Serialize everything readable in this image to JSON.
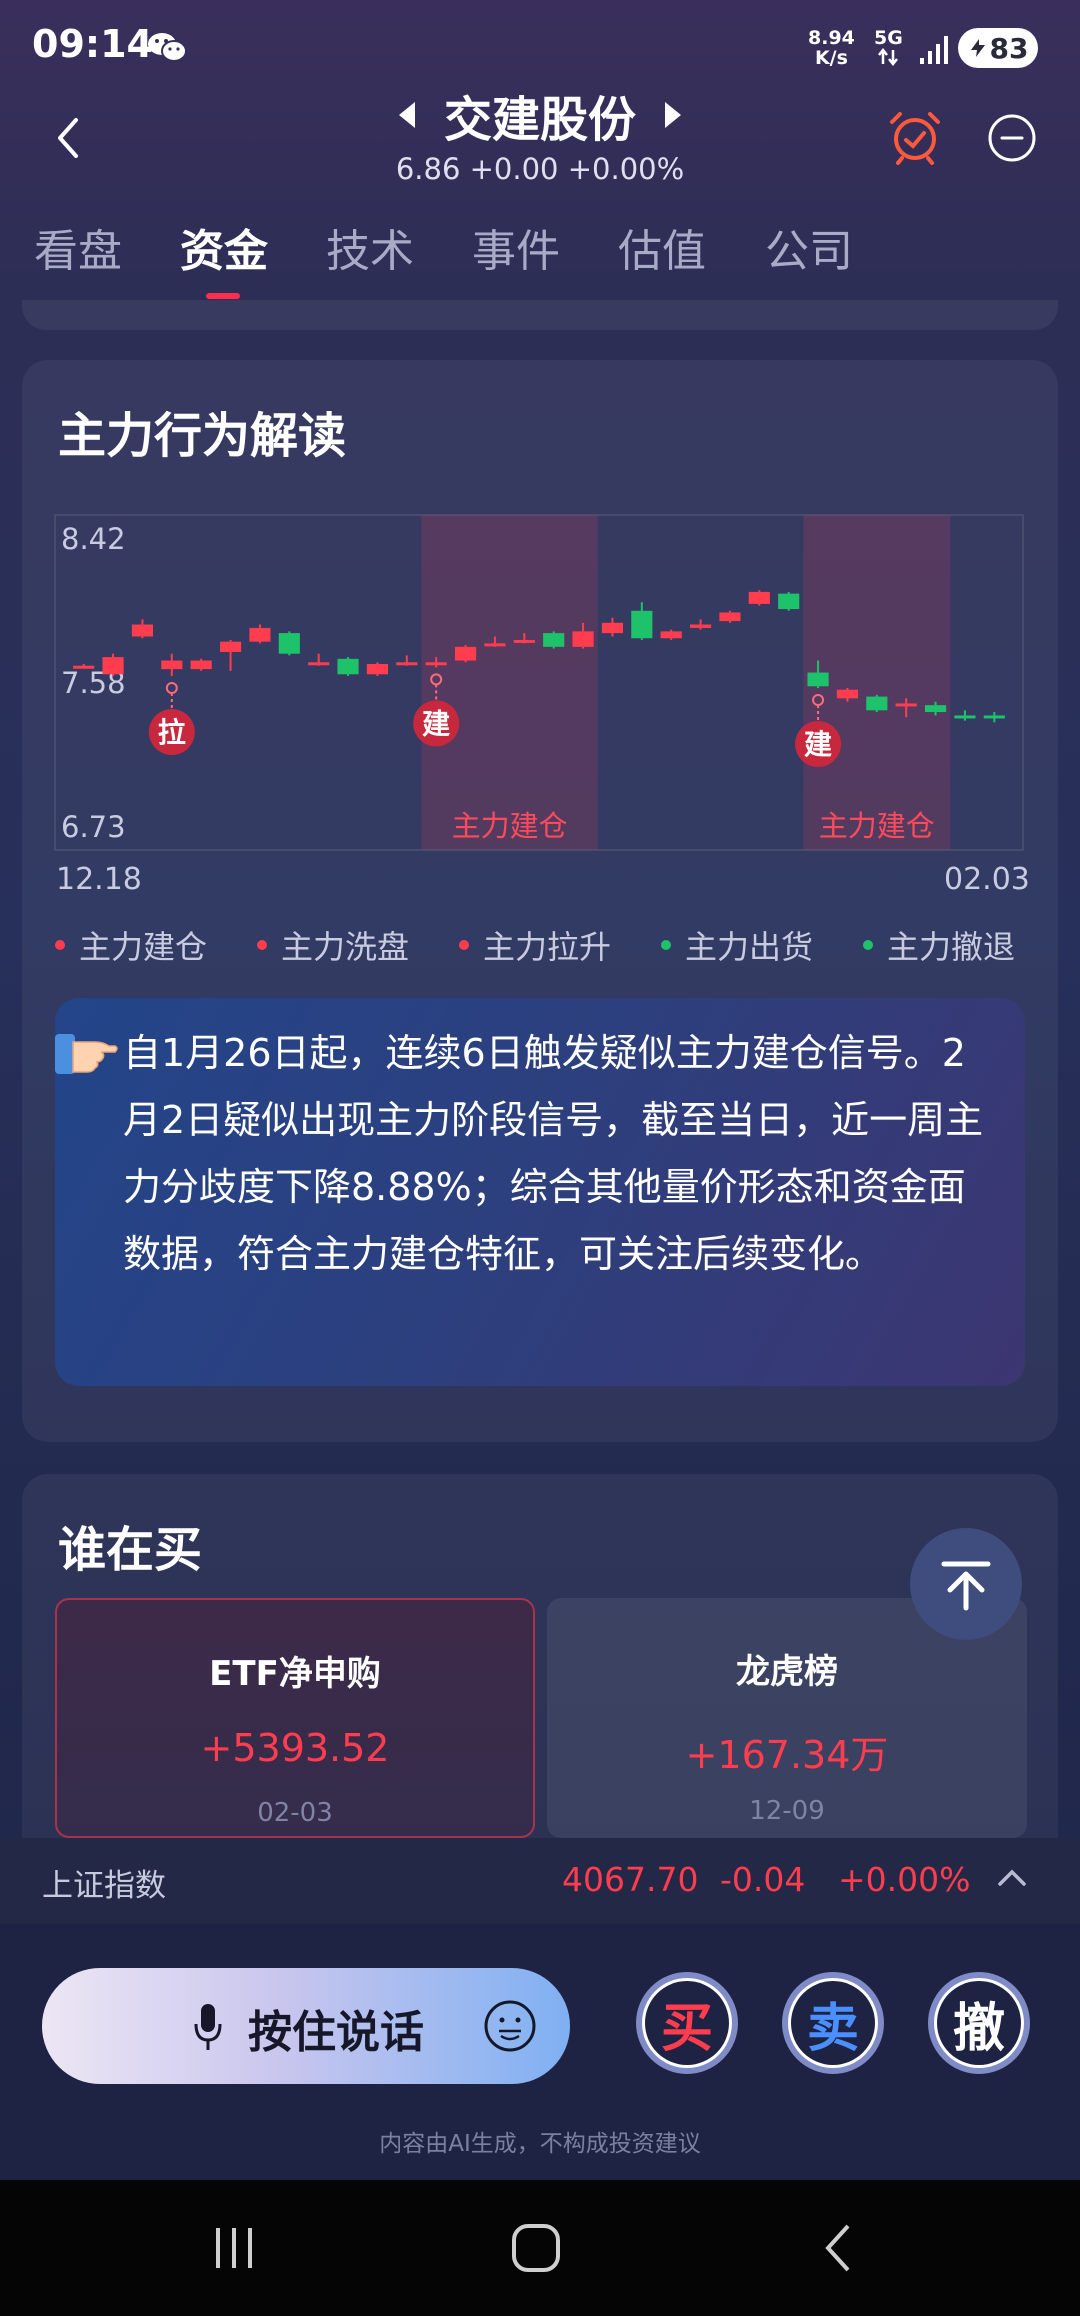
{
  "status_bar": {
    "time": "09:14",
    "net_speed_value": "8.94",
    "net_speed_unit": "K/s",
    "network": "5G",
    "battery": "83",
    "icons": [
      "wechat-icon",
      "data-arrows-icon",
      "signal-icon",
      "charging-icon"
    ]
  },
  "header": {
    "title": "交建股份",
    "price_line": "6.86 +0.00 +0.00%",
    "icons": [
      "back-icon",
      "prev-stock-icon",
      "next-stock-icon",
      "alarm-clock-icon",
      "minus-circle-icon"
    ]
  },
  "tabs": [
    {
      "label": "看盘",
      "active": false
    },
    {
      "label": "资金",
      "active": true
    },
    {
      "label": "技术",
      "active": false
    },
    {
      "label": "事件",
      "active": false
    },
    {
      "label": "估值",
      "active": false
    },
    {
      "label": "公司",
      "active": false
    }
  ],
  "main_behavior": {
    "title": "主力行为解读",
    "legend": [
      {
        "label": "主力建仓",
        "color": "#ff3d4f"
      },
      {
        "label": "主力洗盘",
        "color": "#ff3d4f"
      },
      {
        "label": "主力拉升",
        "color": "#ff3d4f"
      },
      {
        "label": "主力出货",
        "color": "#1ec26a"
      },
      {
        "label": "主力撤退",
        "color": "#1ec26a"
      }
    ],
    "insight": "自1月26日起，连续6日触发疑似主力建仓信号。2月2日疑似出现主力阶段信号，截至当日，近一周主力分歧度下降8.88%；综合其他量价形态和资金面数据，符合主力建仓特征，可关注后续变化。"
  },
  "chart_data": {
    "type": "candlestick",
    "y_tick_labels": [
      "8.42",
      "7.58",
      "6.73"
    ],
    "ylim": [
      6.73,
      8.42
    ],
    "x_tick_labels": [
      "12.18",
      "02.03"
    ],
    "up_color": "#ff3d4f",
    "down_color": "#1ec26a",
    "candles": [
      {
        "o": 7.67,
        "c": 7.67,
        "h": 7.68,
        "l": 7.66
      },
      {
        "o": 7.62,
        "c": 7.72,
        "h": 7.74,
        "l": 7.61
      },
      {
        "o": 7.84,
        "c": 7.91,
        "h": 7.94,
        "l": 7.83
      },
      {
        "o": 7.65,
        "c": 7.7,
        "h": 7.74,
        "l": 7.61
      },
      {
        "o": 7.65,
        "c": 7.7,
        "h": 7.71,
        "l": 7.64
      },
      {
        "o": 7.75,
        "c": 7.81,
        "h": 7.82,
        "l": 7.64
      },
      {
        "o": 7.81,
        "c": 7.89,
        "h": 7.91,
        "l": 7.8
      },
      {
        "o": 7.86,
        "c": 7.74,
        "h": 7.87,
        "l": 7.73
      },
      {
        "o": 7.69,
        "c": 7.69,
        "h": 7.74,
        "l": 7.67
      },
      {
        "o": 7.71,
        "c": 7.62,
        "h": 7.72,
        "l": 7.61
      },
      {
        "o": 7.62,
        "c": 7.68,
        "h": 7.69,
        "l": 7.61
      },
      {
        "o": 7.68,
        "c": 7.69,
        "h": 7.73,
        "l": 7.67
      },
      {
        "o": 7.69,
        "c": 7.69,
        "h": 7.72,
        "l": 7.66
      },
      {
        "o": 7.7,
        "c": 7.78,
        "h": 7.79,
        "l": 7.69
      },
      {
        "o": 7.79,
        "c": 7.8,
        "h": 7.84,
        "l": 7.78
      },
      {
        "o": 7.81,
        "c": 7.82,
        "h": 7.86,
        "l": 7.8
      },
      {
        "o": 7.86,
        "c": 7.78,
        "h": 7.87,
        "l": 7.77
      },
      {
        "o": 7.78,
        "c": 7.87,
        "h": 7.92,
        "l": 7.77
      },
      {
        "o": 7.86,
        "c": 7.92,
        "h": 7.95,
        "l": 7.84
      },
      {
        "o": 7.99,
        "c": 7.83,
        "h": 8.04,
        "l": 7.82
      },
      {
        "o": 7.83,
        "c": 7.87,
        "h": 7.88,
        "l": 7.82
      },
      {
        "o": 7.89,
        "c": 7.91,
        "h": 7.94,
        "l": 7.88
      },
      {
        "o": 7.93,
        "c": 7.98,
        "h": 7.99,
        "l": 7.92
      },
      {
        "o": 8.03,
        "c": 8.1,
        "h": 8.11,
        "l": 8.02
      },
      {
        "o": 8.09,
        "c": 8.0,
        "h": 8.1,
        "l": 7.99
      },
      {
        "o": 7.63,
        "c": 7.55,
        "h": 7.7,
        "l": 7.54
      },
      {
        "o": 7.48,
        "c": 7.53,
        "h": 7.54,
        "l": 7.46
      },
      {
        "o": 7.49,
        "c": 7.41,
        "h": 7.5,
        "l": 7.4
      },
      {
        "o": 7.44,
        "c": 7.45,
        "h": 7.48,
        "l": 7.37
      },
      {
        "o": 7.44,
        "c": 7.4,
        "h": 7.46,
        "l": 7.38
      },
      {
        "o": 7.38,
        "c": 7.37,
        "h": 7.41,
        "l": 7.35
      },
      {
        "o": 7.38,
        "c": 7.37,
        "h": 7.4,
        "l": 7.34
      }
    ],
    "zones": [
      {
        "label": "主力建仓",
        "from_index": 12,
        "to_index": 17
      },
      {
        "label": "主力建仓",
        "from_index": 25,
        "to_index": 29
      }
    ],
    "markers": [
      {
        "label": "拉",
        "index": 3
      },
      {
        "label": "建",
        "index": 12
      },
      {
        "label": "建",
        "index": 25
      }
    ]
  },
  "who_buys": {
    "title": "谁在买",
    "cards": [
      {
        "title": "ETF净申购",
        "value": "+5393.52",
        "date": "02-03"
      },
      {
        "title": "龙虎榜",
        "value": "+167.34万",
        "date": "12-09"
      }
    ],
    "to_top_icon": "scroll-to-top-icon"
  },
  "index_bar": {
    "name": "上证指数",
    "value": "4067.70",
    "change": "-0.04",
    "change_pct": "+0.00%",
    "icon": "caret-up-icon"
  },
  "bottom_bar": {
    "voice_label": "按住说话",
    "buy_label": "买",
    "sell_label": "卖",
    "cancel_label": "撤",
    "disclaimer": "内容由AI生成，不构成投资建议",
    "icons": [
      "mic-icon",
      "emoji-icon"
    ]
  },
  "nav_bar": {
    "icons": [
      "recents-icon",
      "home-icon",
      "back-nav-icon"
    ]
  }
}
